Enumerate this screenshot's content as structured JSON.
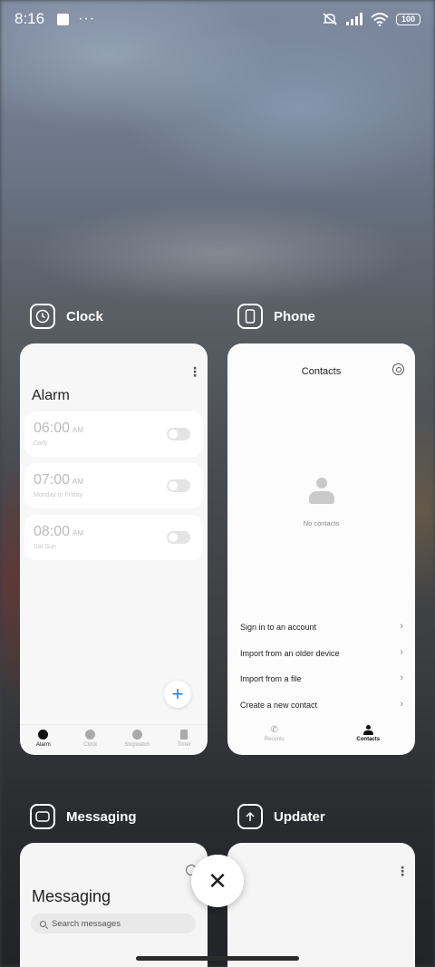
{
  "status_bar": {
    "time": "8:16",
    "battery": "100"
  },
  "apps": {
    "clock": {
      "name": "Clock"
    },
    "phone": {
      "name": "Phone"
    },
    "messaging": {
      "name": "Messaging"
    },
    "updater": {
      "name": "Updater"
    }
  },
  "clock_card": {
    "title": "Alarm",
    "alarms": [
      {
        "time": "06:00",
        "ampm": "AM",
        "repeat": "Daily"
      },
      {
        "time": "07:00",
        "ampm": "AM",
        "repeat": "Monday to Friday"
      },
      {
        "time": "08:00",
        "ampm": "AM",
        "repeat": "Sat Sun"
      }
    ],
    "nav": [
      "Alarm",
      "Clock",
      "Stopwatch",
      "Timer"
    ]
  },
  "phone_card": {
    "title": "Contacts",
    "empty_text": "No contacts",
    "options": [
      "Sign in to an account",
      "Import from an older device",
      "Import from a file",
      "Create a new contact"
    ],
    "nav": [
      "Recents",
      "Contacts"
    ]
  },
  "messaging_card": {
    "title": "Messaging",
    "search_placeholder": "Search messages"
  },
  "close_symbol": "✕"
}
